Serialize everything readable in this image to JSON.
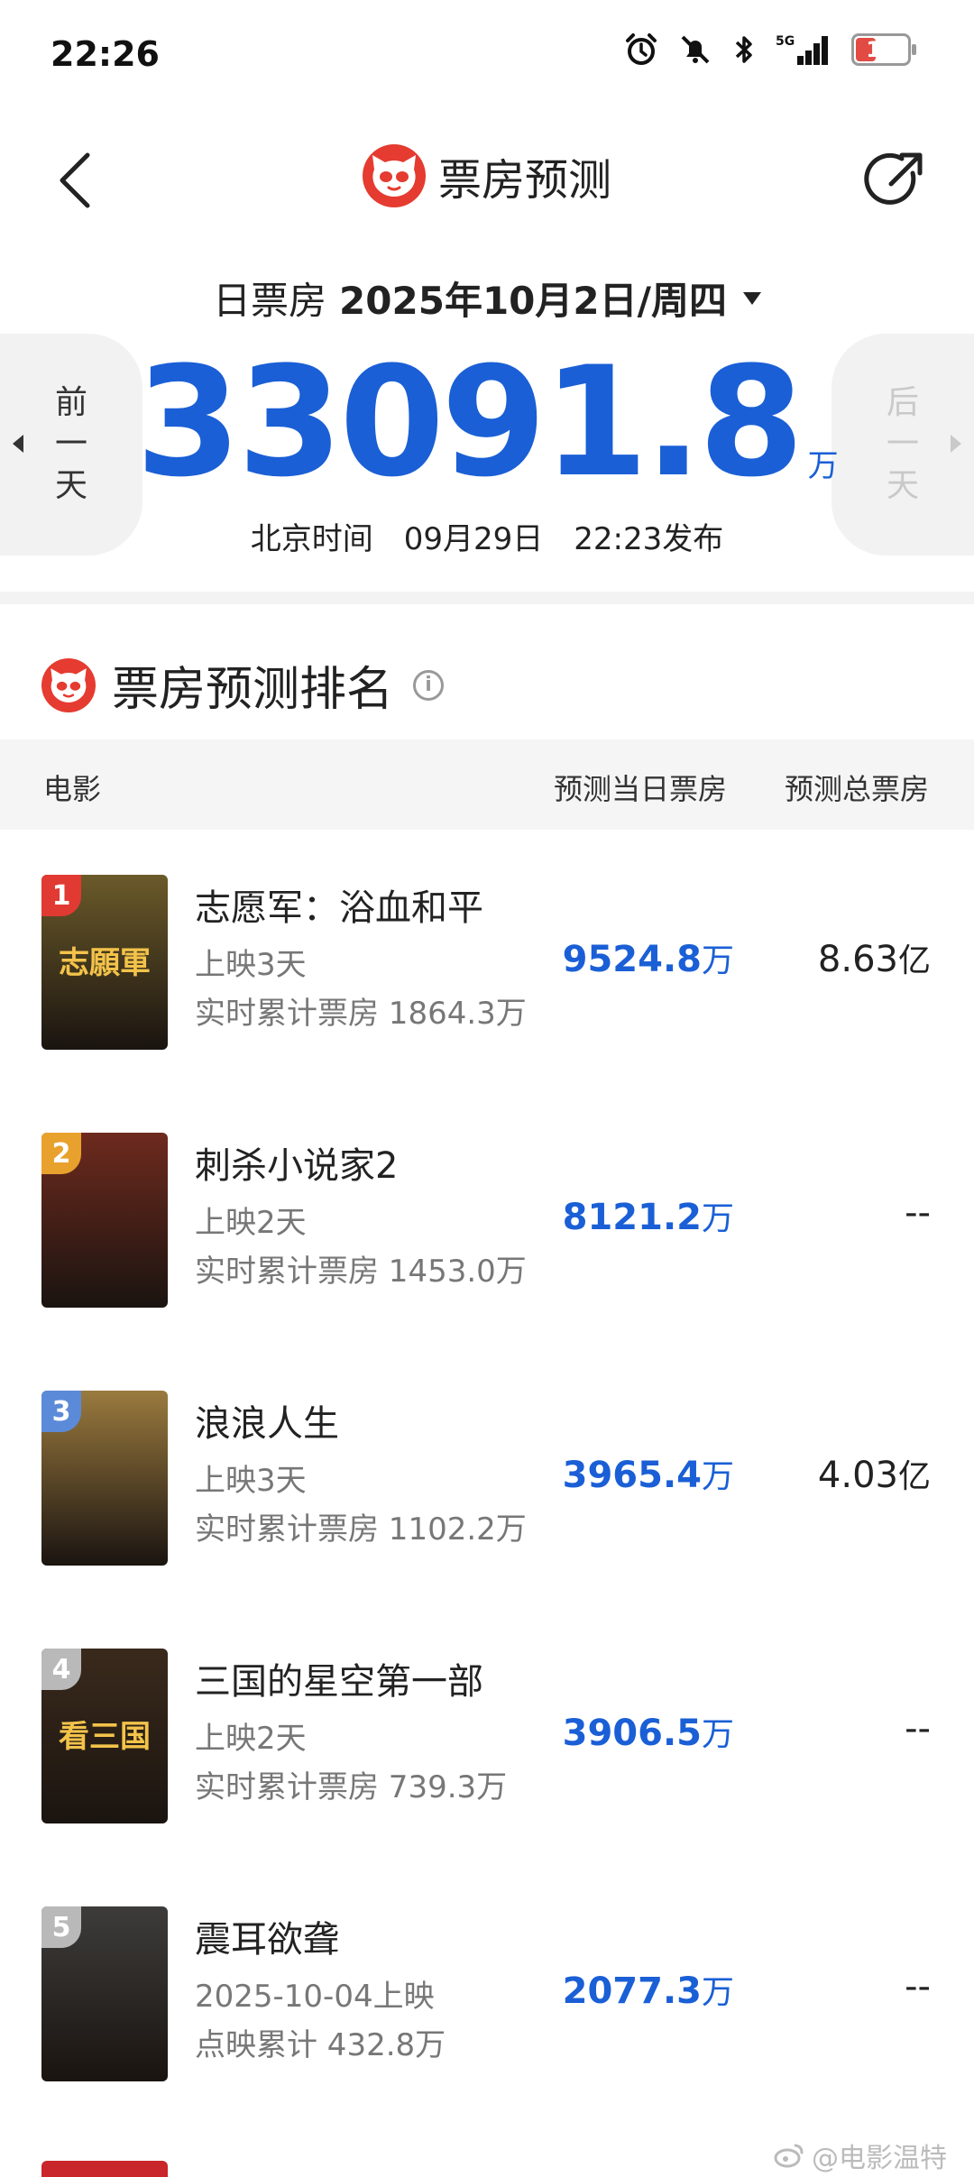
{
  "status_bar": {
    "time": "22:26",
    "network": "5G",
    "battery": "17"
  },
  "header": {
    "title": "票房预测"
  },
  "date_row": {
    "label": "日票房",
    "date": "2025年10月2日/周四"
  },
  "nav": {
    "prev": [
      "前",
      "一",
      "天"
    ],
    "next": [
      "后",
      "一",
      "天"
    ]
  },
  "total": {
    "value": "33091.8",
    "unit": "万"
  },
  "publish": "北京时间　09月29日　22:23发布",
  "ranking": {
    "title": "票房预测排名",
    "columns": {
      "movie": "电影",
      "day": "预测当日票房",
      "total": "预测总票房"
    },
    "rows": [
      {
        "rank": "1",
        "name": "志愿军：浴血和平",
        "sub1": "上映3天",
        "sub2": "实时累计票房 1864.3万",
        "day_value": "9524.8",
        "day_unit": "万",
        "total_value": "8.63",
        "total_unit": "亿",
        "badge_color": "#e03a33",
        "poster_text": "志願軍",
        "poster_bg": "#6b5a2a"
      },
      {
        "rank": "2",
        "name": "刺杀小说家2",
        "sub1": "上映2天",
        "sub2": "实时累计票房 1453.0万",
        "day_value": "8121.2",
        "day_unit": "万",
        "total_value": "--",
        "total_unit": "",
        "badge_color": "#e9a12d",
        "poster_text": "",
        "poster_bg": "#6e2a1e"
      },
      {
        "rank": "3",
        "name": "浪浪人生",
        "sub1": "上映3天",
        "sub2": "实时累计票房 1102.2万",
        "day_value": "3965.4",
        "day_unit": "万",
        "total_value": "4.03",
        "total_unit": "亿",
        "badge_color": "#5b8bd8",
        "poster_text": "",
        "poster_bg": "#9a7a3e"
      },
      {
        "rank": "4",
        "name": "三国的星空第一部",
        "sub1": "上映2天",
        "sub2": "实时累计票房 739.3万",
        "day_value": "3906.5",
        "day_unit": "万",
        "total_value": "--",
        "total_unit": "",
        "badge_color": "#b9b9b9",
        "poster_text": "看三国",
        "poster_bg": "#3a2a1c"
      },
      {
        "rank": "5",
        "name": "震耳欲聋",
        "sub1": "2025-10-04上映",
        "sub2": "点映累计 432.8万",
        "day_value": "2077.3",
        "day_unit": "万",
        "total_value": "--",
        "total_unit": "",
        "badge_color": "#b9b9b9",
        "poster_text": "",
        "poster_bg": "#3d3c3a"
      }
    ]
  },
  "watermark": "@电影温特"
}
